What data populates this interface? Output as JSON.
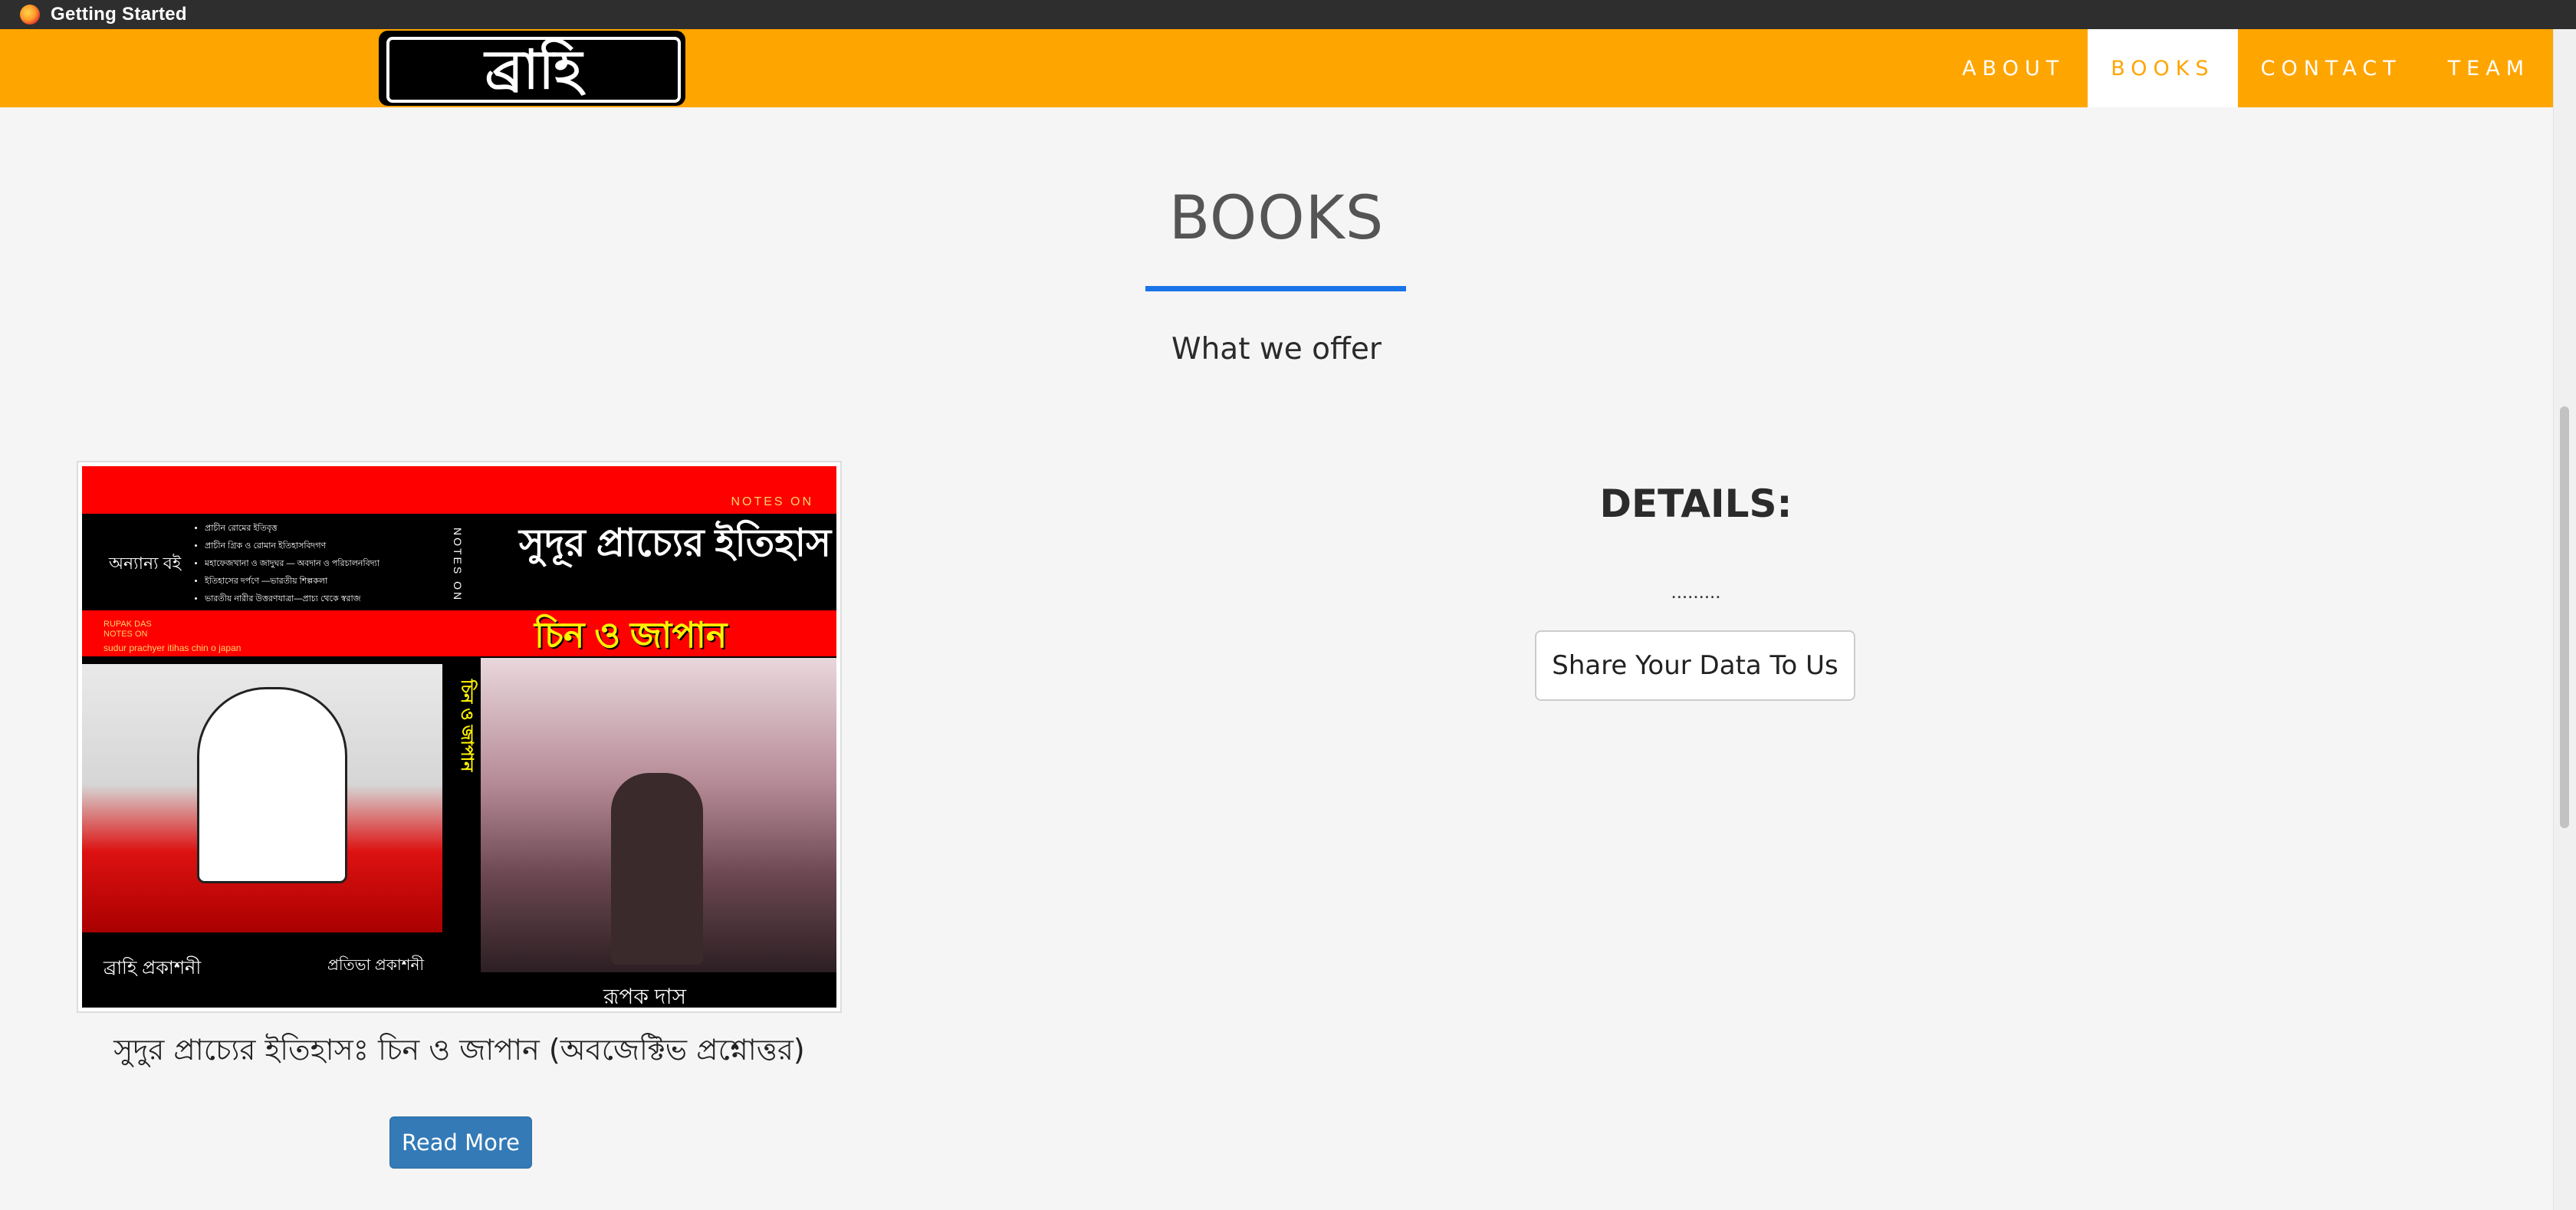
{
  "window": {
    "title": "Getting Started",
    "app_icon": "firefox-icon"
  },
  "brand": {
    "logo_text": "ব্রাহি"
  },
  "nav": {
    "items": [
      {
        "label": "ABOUT",
        "active": false
      },
      {
        "label": "BOOKS",
        "active": true
      },
      {
        "label": "CONTACT",
        "active": false
      },
      {
        "label": "TEAM",
        "active": false
      }
    ]
  },
  "colors": {
    "nav_bg": "#ffa500",
    "accent_underline": "#1a73e8",
    "read_more_bg": "#337ab7"
  },
  "section": {
    "title": "BOOKS",
    "subtitle": "What we offer"
  },
  "book": {
    "title": "সুদুর প্রাচ্যের ইতিহাসঃ চিন ও জাপান (অবজেক্টিভ প্রশ্নোত্তর)",
    "read_more_label": "Read More",
    "cover": {
      "notes_on": "NOTES ON",
      "other_books": "অন্যান্য বই",
      "bullets": [
        "প্রাচীন রোমের ইতিবৃত্ত",
        "প্রাচীন গ্রিক ও রোমান ইতিহাসবিদগণ",
        "মহাফেজখানা ও জাদুঘর — অবদান ও পরিচালনবিদ্যা",
        "ইতিহাসের দর্পণে —ভারতীয় শিল্পকলা",
        "ভারতীয় নারীর উত্তরণযাত্রা—প্রাচ্য থেকে স্বরাজ"
      ],
      "vertical_notes": "NOTES ON",
      "main_title": "সুদূর প্রাচ্যের ইতিহাস",
      "subtitle": "চিন ও জাপান",
      "author_tag": "RUPAK DAS",
      "author_tag_sub": "NOTES ON",
      "romanized": "sudur prachyer itihas chin o japan",
      "spine_text": "চিন ও জাপান",
      "publisher_left": "ব্রাহি প্রকাশনী",
      "publisher_right": "প্রতিভা প্রকাশনী",
      "author_bottom": "রূপক দাস"
    }
  },
  "details": {
    "title": "DETAILS:",
    "dots": ".........",
    "share_label": "Share Your Data To Us"
  }
}
